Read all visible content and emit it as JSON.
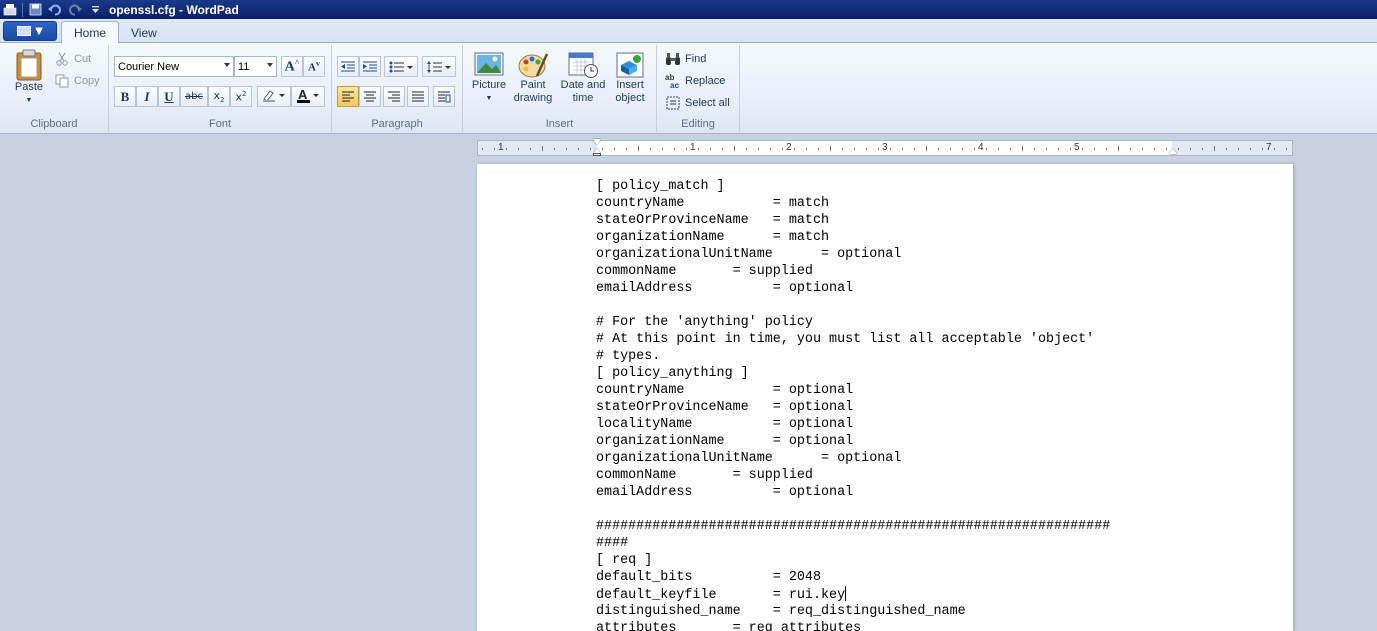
{
  "window": {
    "title": "openssl.cfg - WordPad"
  },
  "tabs": [
    {
      "label": "Home",
      "active": true
    },
    {
      "label": "View",
      "active": false
    }
  ],
  "ribbon": {
    "clipboard": {
      "paste": "Paste",
      "cut": "Cut",
      "copy": "Copy",
      "label": "Clipboard"
    },
    "font": {
      "family": "Courier New",
      "size": "11",
      "label": "Font"
    },
    "paragraph": {
      "label": "Paragraph"
    },
    "insert": {
      "picture": "Picture",
      "paint_line1": "Paint",
      "paint_line2": "drawing",
      "date_line1": "Date and",
      "date_line2": "time",
      "object_line1": "Insert",
      "object_line2": "object",
      "label": "Insert"
    },
    "editing": {
      "find": "Find",
      "replace": "Replace",
      "select_all": "Select all",
      "label": "Editing"
    }
  },
  "ruler": {
    "numbers": [
      "1",
      "1",
      "2",
      "3",
      "4",
      "5",
      "7"
    ]
  },
  "document": {
    "lines": [
      "[ policy_match ]",
      "countryName           = match",
      "stateOrProvinceName   = match",
      "organizationName      = match",
      "organizationalUnitName      = optional",
      "commonName       = supplied",
      "emailAddress          = optional",
      "",
      "# For the 'anything' policy",
      "# At this point in time, you must list all acceptable 'object'",
      "# types.",
      "[ policy_anything ]",
      "countryName           = optional",
      "stateOrProvinceName   = optional",
      "localityName          = optional",
      "organizationName      = optional",
      "organizationalUnitName      = optional",
      "commonName       = supplied",
      "emailAddress          = optional",
      "",
      "################################################################",
      "####",
      "[ req ]",
      "default_bits          = 2048",
      "default_keyfile       = rui.key",
      "distinguished_name    = req_distinguished_name",
      "attributes       = req_attributes"
    ]
  },
  "colors": {
    "titlebar": "#0a1f66",
    "ribbon": "#e7eef8",
    "workspace": "#c7d1e0",
    "page": "#ffffff"
  }
}
